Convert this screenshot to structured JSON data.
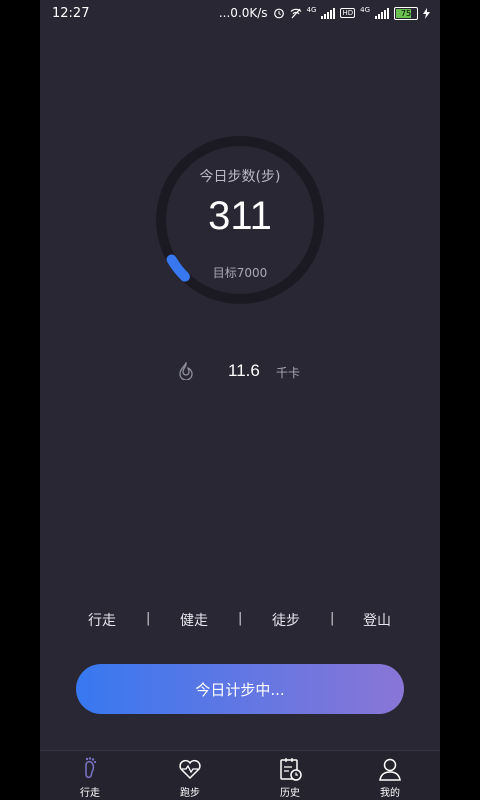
{
  "status_bar": {
    "time": "12:27",
    "network_speed": "...0.0K/s",
    "signal1": "4G",
    "signal2": "4G",
    "hd": "HD",
    "battery": "75"
  },
  "counter": {
    "label": "今日步数(步)",
    "steps": "311",
    "goal_text": "目标7000",
    "progress": 0.044
  },
  "calories": {
    "value": "11.6",
    "unit": "千卡",
    "icon": "flame-icon"
  },
  "modes": [
    "行走",
    "健走",
    "徒步",
    "登山"
  ],
  "start_button": {
    "label": "今日计步中..."
  },
  "nav": [
    {
      "label": "行走",
      "icon": "footprint-icon",
      "active": true
    },
    {
      "label": "跑步",
      "icon": "heartbeat-icon"
    },
    {
      "label": "历史",
      "icon": "history-icon"
    },
    {
      "label": "我的",
      "icon": "user-icon"
    }
  ],
  "colors": {
    "background": "#282733",
    "accent": "#3778f0",
    "gradient_end": "#8a76d6",
    "ring_track": "#1b1a22"
  }
}
